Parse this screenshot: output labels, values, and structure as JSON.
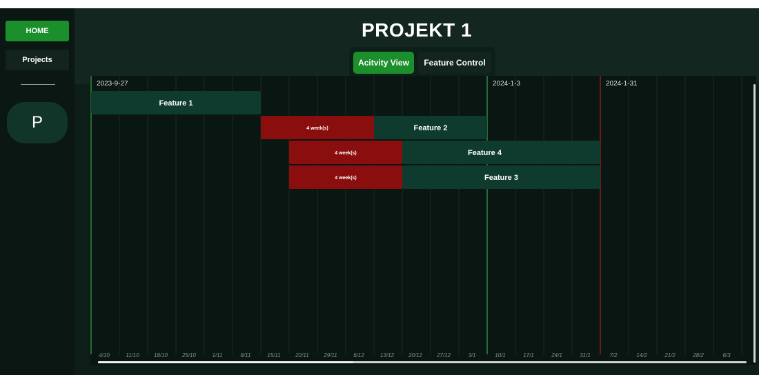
{
  "sidebar": {
    "home_label": "HOME",
    "projects_label": "Projects",
    "avatar_letter": "P"
  },
  "header": {
    "title": "PROJEKT 1",
    "tabs": [
      {
        "label": "Acitvity View",
        "active": true
      },
      {
        "label": "Feature Control",
        "active": false
      }
    ]
  },
  "timeline": {
    "date_labels": [
      "2023-9-27",
      "2024-1-3",
      "2024-1-31"
    ],
    "week_ticks": [
      "4/10",
      "11/10",
      "18/10",
      "25/10",
      "1/11",
      "8/11",
      "15/11",
      "22/11",
      "29/11",
      "6/12",
      "13/12",
      "20/12",
      "27/12",
      "3/1",
      "10/1",
      "17/1",
      "24/1",
      "31/1",
      "7/2",
      "14/2",
      "21/2",
      "28/2",
      "6/3"
    ],
    "today_marker_date": "2024-1-3",
    "deadline_marker_date": "2024-1-31",
    "colors": {
      "feature_bar": "#0f3b2e",
      "delay_bar": "#8a0e0e",
      "today_line": "#2f8a3a",
      "deadline_line": "#8b1e1e",
      "grid_line": "#1a2a24"
    },
    "rows": [
      {
        "feature": "Feature 1",
        "delay_label": null,
        "start": "2023-9-27",
        "end": "2023-11-8"
      },
      {
        "feature": "Feature 2",
        "delay_label": "4 week(s)",
        "start": "2023-12-6",
        "end": "2024-1-3"
      },
      {
        "feature": "Feature 4",
        "delay_label": "4 week(s)",
        "start": "2023-12-13",
        "end": "2024-1-31"
      },
      {
        "feature": "Feature 3",
        "delay_label": "4 week(s)",
        "start": "2023-12-13",
        "end": "2024-1-31"
      }
    ]
  }
}
